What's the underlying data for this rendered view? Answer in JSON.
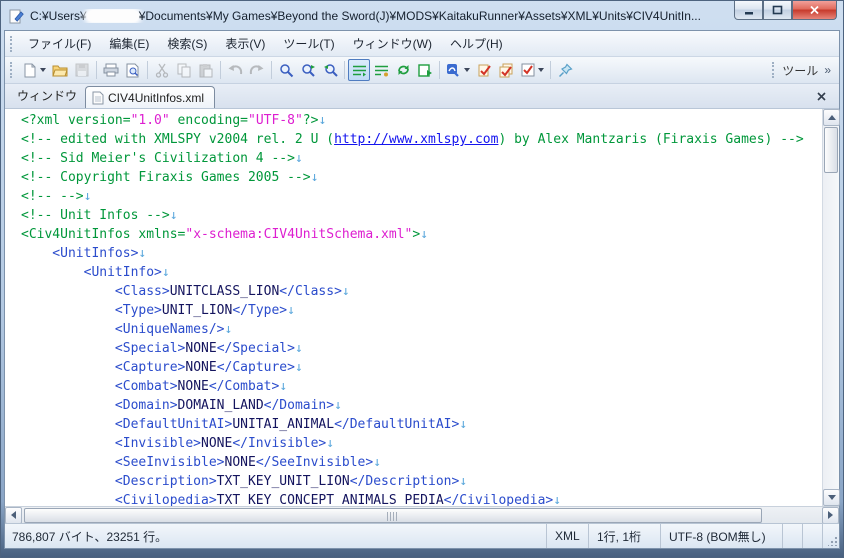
{
  "window": {
    "title_prefix": "C:¥Users¥",
    "title_suffix": "¥Documents¥My Games¥Beyond the Sword(J)¥MODS¥KaitakuRunner¥Assets¥XML¥Units¥CIV4UnitIn...",
    "username_redacted": true
  },
  "menu": {
    "items": [
      {
        "label": "ファイル(F)"
      },
      {
        "label": "編集(E)"
      },
      {
        "label": "検索(S)"
      },
      {
        "label": "表示(V)"
      },
      {
        "label": "ツール(T)"
      },
      {
        "label": "ウィンドウ(W)"
      },
      {
        "label": "ヘルプ(H)"
      }
    ]
  },
  "toolbar": {
    "tools_label": "ツール",
    "overflow_chevron": "»",
    "icons": [
      "new-document",
      "open-file",
      "save",
      "print",
      "print-preview",
      "cut",
      "copy",
      "paste",
      "undo",
      "redo",
      "find",
      "find-next",
      "find-previous",
      "wrap-by-window",
      "wrap-mode-2",
      "refresh-mode",
      "wrap-mode-4",
      "encoding",
      "compare",
      "compare-all",
      "option-check",
      "pin"
    ]
  },
  "tabbar": {
    "panel_label": "ウィンドウ",
    "tabs": [
      {
        "label": "CIV4UnitInfos.xml",
        "active": true
      }
    ]
  },
  "editor": {
    "newline_marker": "↓",
    "lines": [
      {
        "m": true,
        "seg": [
          {
            "c": "g",
            "t": "<?xml version="
          },
          {
            "c": "s",
            "t": "\"1.0\""
          },
          {
            "c": "g",
            "t": " encoding="
          },
          {
            "c": "s",
            "t": "\"UTF-8\""
          },
          {
            "c": "g",
            "t": "?>"
          }
        ]
      },
      {
        "m": false,
        "seg": [
          {
            "c": "g",
            "t": "<!-- edited with XMLSPY v2004 rel. 2 U ("
          },
          {
            "c": "u",
            "t": "http://www.xmlspy.com"
          },
          {
            "c": "g",
            "t": ") by Alex Mantzaris (Firaxis Games) -->"
          }
        ]
      },
      {
        "m": true,
        "seg": [
          {
            "c": "g",
            "t": "<!-- Sid Meier's Civilization 4 -->"
          }
        ]
      },
      {
        "m": true,
        "seg": [
          {
            "c": "g",
            "t": "<!-- Copyright Firaxis Games 2005 -->"
          }
        ]
      },
      {
        "m": true,
        "seg": [
          {
            "c": "g",
            "t": "<!-- -->"
          }
        ]
      },
      {
        "m": true,
        "seg": [
          {
            "c": "g",
            "t": "<!-- Unit Infos -->"
          }
        ]
      },
      {
        "m": true,
        "seg": [
          {
            "c": "g",
            "t": "<Civ4UnitInfos xmlns="
          },
          {
            "c": "s",
            "t": "\"x-schema:CIV4UnitSchema.xml\""
          },
          {
            "c": "g",
            "t": ">"
          }
        ]
      },
      {
        "m": true,
        "seg": [
          {
            "c": "t",
            "t": "    <UnitInfos>"
          }
        ]
      },
      {
        "m": true,
        "seg": [
          {
            "c": "t",
            "t": "        <UnitInfo>"
          }
        ]
      },
      {
        "m": true,
        "seg": [
          {
            "c": "t",
            "t": "            <Class>"
          },
          {
            "c": "x",
            "t": "UNITCLASS_LION"
          },
          {
            "c": "t",
            "t": "</Class>"
          }
        ]
      },
      {
        "m": true,
        "seg": [
          {
            "c": "t",
            "t": "            <Type>"
          },
          {
            "c": "x",
            "t": "UNIT_LION"
          },
          {
            "c": "t",
            "t": "</Type>"
          }
        ]
      },
      {
        "m": true,
        "seg": [
          {
            "c": "t",
            "t": "            <UniqueNames/>"
          }
        ]
      },
      {
        "m": true,
        "seg": [
          {
            "c": "t",
            "t": "            <Special>"
          },
          {
            "c": "x",
            "t": "NONE"
          },
          {
            "c": "t",
            "t": "</Special>"
          }
        ]
      },
      {
        "m": true,
        "seg": [
          {
            "c": "t",
            "t": "            <Capture>"
          },
          {
            "c": "x",
            "t": "NONE"
          },
          {
            "c": "t",
            "t": "</Capture>"
          }
        ]
      },
      {
        "m": true,
        "seg": [
          {
            "c": "t",
            "t": "            <Combat>"
          },
          {
            "c": "x",
            "t": "NONE"
          },
          {
            "c": "t",
            "t": "</Combat>"
          }
        ]
      },
      {
        "m": true,
        "seg": [
          {
            "c": "t",
            "t": "            <Domain>"
          },
          {
            "c": "x",
            "t": "DOMAIN_LAND"
          },
          {
            "c": "t",
            "t": "</Domain>"
          }
        ]
      },
      {
        "m": true,
        "seg": [
          {
            "c": "t",
            "t": "            <DefaultUnitAI>"
          },
          {
            "c": "x",
            "t": "UNITAI_ANIMAL"
          },
          {
            "c": "t",
            "t": "</DefaultUnitAI>"
          }
        ]
      },
      {
        "m": true,
        "seg": [
          {
            "c": "t",
            "t": "            <Invisible>"
          },
          {
            "c": "x",
            "t": "NONE"
          },
          {
            "c": "t",
            "t": "</Invisible>"
          }
        ]
      },
      {
        "m": true,
        "seg": [
          {
            "c": "t",
            "t": "            <SeeInvisible>"
          },
          {
            "c": "x",
            "t": "NONE"
          },
          {
            "c": "t",
            "t": "</SeeInvisible>"
          }
        ]
      },
      {
        "m": true,
        "seg": [
          {
            "c": "t",
            "t": "            <Description>"
          },
          {
            "c": "x",
            "t": "TXT_KEY_UNIT_LION"
          },
          {
            "c": "t",
            "t": "</Description>"
          }
        ]
      },
      {
        "m": true,
        "seg": [
          {
            "c": "t",
            "t": "            <Civilopedia>"
          },
          {
            "c": "x",
            "t": "TXT_KEY_CONCEPT_ANIMALS_PEDIA"
          },
          {
            "c": "t",
            "t": "</Civilopedia>"
          }
        ]
      }
    ]
  },
  "statusbar": {
    "left": "786,807 バイト、23251 行。",
    "cells": [
      "XML",
      "1行, 1桁",
      "UTF-8 (BOM無し)"
    ]
  },
  "colors": {
    "comment_green": "#00973a",
    "string_magenta": "#dd1ed0",
    "tag_blue": "#2b4ccc",
    "text_navy": "#14145e",
    "link_blue": "#1414ee",
    "newline_mark": "#5aa7dc",
    "close_button_red": "#c6392b",
    "frame_blue": "#b3c9e2"
  }
}
